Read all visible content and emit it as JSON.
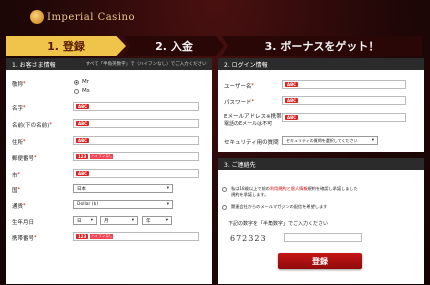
{
  "header": {
    "logo_text": "Imperial Casino"
  },
  "steps": [
    {
      "label": "1. 登録"
    },
    {
      "label": "2. 入金"
    },
    {
      "label": "3. ボーナスをゲット！"
    }
  ],
  "left_panel": {
    "title": "1. お客さま情報",
    "note": "すべて「半角英数字」で（ハイフンなし）でご入力ください",
    "fields": {
      "title_label": "敬称",
      "title_options": [
        "Mr",
        "Ms"
      ],
      "surname_label": "名字",
      "givenname_label": "名前(下の名前)",
      "address_label": "住所",
      "postal_label": "郵便番号",
      "city_label": "市",
      "country_label": "国",
      "country_value": "日本",
      "currency_label": "通貨",
      "currency_value": "Dollar ($)",
      "dob_label": "生年月日",
      "dob_day": "日",
      "dob_month": "月",
      "dob_year": "年",
      "phone_label": "携帯番号"
    },
    "badges": {
      "abc": "ABC",
      "num": "123",
      "num_note": "ハイフンなし"
    },
    "required_mark": "*"
  },
  "login_panel": {
    "title": "2. ログイン情報",
    "username_label": "ユーザー名",
    "password_label": "パスワード",
    "email_label": "Eメールアドレス※携帯",
    "email_note": "電話のEメールは不可",
    "security_label": "セキュリティ用の質問",
    "security_value": "セキュリティの質問を選択してください"
  },
  "confirm_panel": {
    "title": "3. ご連絡先",
    "terms_text_a": "私は18歳以上で前の",
    "terms_link": "利用規約と個人情報",
    "terms_text_b": "規約を確認し承諾しました",
    "terms_text_c": "規約を承諾します。",
    "newsletter_text": "関連会社からのメールマガジンの配信を希望します",
    "captcha_prompt": "下記の数字を「半角数字」でご入力ください",
    "captcha_value": "672323",
    "submit_label": "登録"
  },
  "colors": {
    "accent": "#f0c44a",
    "button": "#b01010",
    "badge": "#dd2222"
  }
}
